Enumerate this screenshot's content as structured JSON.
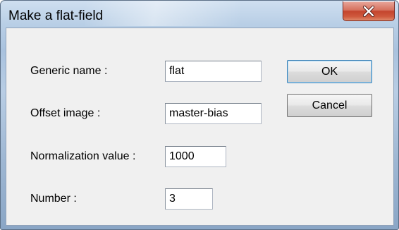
{
  "window": {
    "title": "Make a flat-field"
  },
  "form": {
    "generic_name": {
      "label": "Generic name :",
      "value": "flat"
    },
    "offset_image": {
      "label": "Offset image :",
      "value": "master-bias"
    },
    "normalization_value": {
      "label": "Normalization value :",
      "value": "1000"
    },
    "number": {
      "label": "Number :",
      "value": "3"
    }
  },
  "buttons": {
    "ok": "OK",
    "cancel": "Cancel"
  },
  "icons": {
    "close": "close-icon"
  },
  "colors": {
    "close_button": "#c4452e",
    "title_bar": "#b9cfe6",
    "client_background": "#f0f0f0"
  }
}
